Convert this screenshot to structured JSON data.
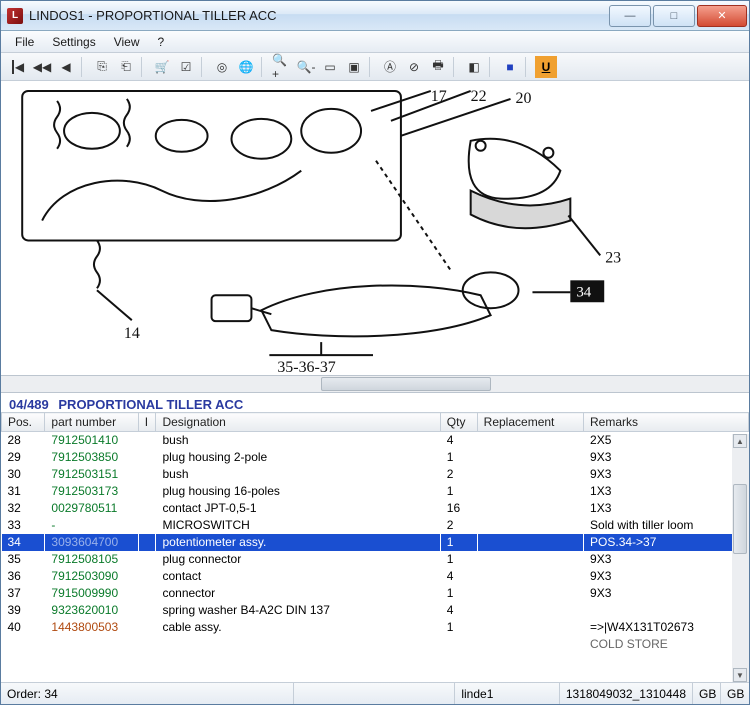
{
  "window": {
    "title": "LINDOS1 - PROPORTIONAL TILLER ACC",
    "appicon_char": "L"
  },
  "menubar": [
    "File",
    "Settings",
    "View",
    "?"
  ],
  "toolbar_icons": [
    "first",
    "prev-fast",
    "prev",
    "sep",
    "copy",
    "paste",
    "sep",
    "cart",
    "check",
    "sep",
    "target",
    "globe",
    "sep",
    "zoom-in",
    "zoom-out",
    "page",
    "fit",
    "sep",
    "find",
    "nav",
    "print",
    "sep",
    "flag",
    "sep",
    "blue-tile",
    "sep",
    "u-mark"
  ],
  "toolbar_glyphs": {
    "first": "◀",
    "prev-fast": "◀◀",
    "prev": "◀",
    "copy": "⎘",
    "paste": "⎗",
    "cart": "🛒",
    "check": "☑",
    "target": "◎",
    "globe": "🌐",
    "zoom-in": "🔍+",
    "zoom-out": "🔍-",
    "page": "▭",
    "fit": "▣",
    "find": "Ⓐ",
    "nav": "⊘",
    "print": "🖶",
    "flag": "◧",
    "blue-tile": "■",
    "u-mark": "U"
  },
  "drawing": {
    "callouts": [
      "14",
      "17",
      "22",
      "20",
      "23",
      "34",
      "35-36-37"
    ],
    "highlight": "34"
  },
  "parts": {
    "index": "04/489",
    "title": "PROPORTIONAL TILLER ACC",
    "columns": [
      "Pos.",
      "part number",
      "I",
      "Designation",
      "Qty",
      "Replacement",
      "Remarks"
    ],
    "rows": [
      {
        "pos": "28",
        "pn": "7912501410",
        "i": "",
        "des": "bush",
        "qty": "4",
        "rep": "",
        "rem": "2X5"
      },
      {
        "pos": "29",
        "pn": "7912503850",
        "i": "",
        "des": "plug housing 2-pole",
        "qty": "1",
        "rep": "",
        "rem": "9X3"
      },
      {
        "pos": "30",
        "pn": "7912503151",
        "i": "",
        "des": "bush",
        "qty": "2",
        "rep": "",
        "rem": "9X3"
      },
      {
        "pos": "31",
        "pn": "7912503173",
        "i": "",
        "des": "plug housing 16-poles",
        "qty": "1",
        "rep": "",
        "rem": "1X3"
      },
      {
        "pos": "32",
        "pn": "0029780511",
        "i": "",
        "des": "contact JPT-0,5-1",
        "qty": "16",
        "rep": "",
        "rem": "1X3"
      },
      {
        "pos": "33",
        "pn": "-",
        "i": "",
        "des": "MICROSWITCH",
        "qty": "2",
        "rep": "",
        "rem": "Sold with tiller loom"
      },
      {
        "pos": "34",
        "pn": "3093604700",
        "i": "",
        "des": "potentiometer assy.",
        "qty": "1",
        "rep": "",
        "rem": "POS.34->37",
        "selected": true
      },
      {
        "pos": "35",
        "pn": "7912508105",
        "i": "",
        "des": "plug connector",
        "qty": "1",
        "rep": "",
        "rem": "9X3"
      },
      {
        "pos": "36",
        "pn": "7912503090",
        "i": "",
        "des": "contact",
        "qty": "4",
        "rep": "",
        "rem": "9X3"
      },
      {
        "pos": "37",
        "pn": "7915009990",
        "i": "",
        "des": "connector",
        "qty": "1",
        "rep": "",
        "rem": "9X3"
      },
      {
        "pos": "39",
        "pn": "9323620010",
        "i": "",
        "des": "spring washer B4-A2C  DIN 137",
        "qty": "4",
        "rep": "",
        "rem": ""
      },
      {
        "pos": "40",
        "pn": "1443800503",
        "i": "",
        "des": "cable assy.",
        "qty": "1",
        "rep": "",
        "rem": "=>|W4X131T02673",
        "alt": true
      }
    ],
    "overflow_remark": "COLD STORE"
  },
  "statusbar": {
    "order_label": "Order:",
    "order_value": "34",
    "user": "linde1",
    "doc": "1318049032_1310448",
    "lang1": "GB",
    "lang2": "GB"
  }
}
